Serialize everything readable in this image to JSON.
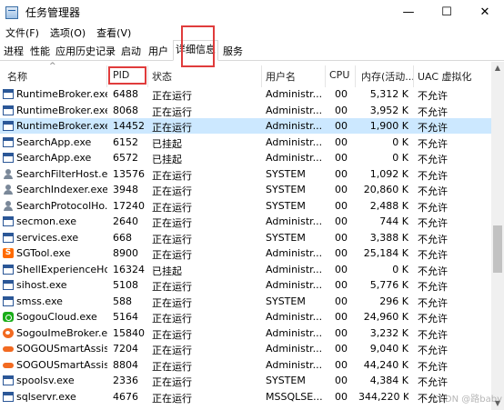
{
  "window": {
    "title": "任务管理器",
    "controls": [
      "—",
      "☐",
      "✕"
    ]
  },
  "menu": [
    "文件(F)",
    "选项(O)",
    "查看(V)"
  ],
  "tabs": [
    {
      "label": "进程",
      "active": false
    },
    {
      "label": "性能",
      "active": false
    },
    {
      "label": "应用历史记录",
      "active": false
    },
    {
      "label": "启动",
      "active": false
    },
    {
      "label": "用户",
      "active": false
    },
    {
      "label": "详细信息",
      "active": true
    },
    {
      "label": "服务",
      "active": false
    }
  ],
  "columns": {
    "name": "名称",
    "pid": "PID",
    "status": "状态",
    "user": "用户名",
    "cpu": "CPU",
    "memory": "内存(活动...",
    "uac": "UAC 虚拟化"
  },
  "rows": [
    {
      "icon": "window-icon",
      "name": "RuntimeBroker.exe",
      "pid": "6488",
      "status": "正在运行",
      "user": "Administr...",
      "cpu": "00",
      "mem": "5,312 K",
      "uac": "不允许"
    },
    {
      "icon": "window-icon",
      "name": "RuntimeBroker.exe",
      "pid": "8068",
      "status": "正在运行",
      "user": "Administr...",
      "cpu": "00",
      "mem": "3,952 K",
      "uac": "不允许"
    },
    {
      "icon": "window-icon",
      "name": "RuntimeBroker.exe",
      "pid": "14452",
      "status": "正在运行",
      "user": "Administr...",
      "cpu": "00",
      "mem": "1,900 K",
      "uac": "不允许",
      "selected": true
    },
    {
      "icon": "window-icon",
      "name": "SearchApp.exe",
      "pid": "6152",
      "status": "已挂起",
      "user": "Administr...",
      "cpu": "00",
      "mem": "0 K",
      "uac": "不允许"
    },
    {
      "icon": "window-icon",
      "name": "SearchApp.exe",
      "pid": "6572",
      "status": "已挂起",
      "user": "Administr...",
      "cpu": "00",
      "mem": "0 K",
      "uac": "不允许"
    },
    {
      "icon": "person-icon",
      "name": "SearchFilterHost.exe",
      "pid": "13576",
      "status": "正在运行",
      "user": "SYSTEM",
      "cpu": "00",
      "mem": "1,092 K",
      "uac": "不允许"
    },
    {
      "icon": "person-icon",
      "name": "SearchIndexer.exe",
      "pid": "3948",
      "status": "正在运行",
      "user": "SYSTEM",
      "cpu": "00",
      "mem": "20,860 K",
      "uac": "不允许"
    },
    {
      "icon": "person-icon",
      "name": "SearchProtocolHo...",
      "pid": "17240",
      "status": "正在运行",
      "user": "SYSTEM",
      "cpu": "00",
      "mem": "2,488 K",
      "uac": "不允许"
    },
    {
      "icon": "window-icon",
      "name": "secmon.exe",
      "pid": "2640",
      "status": "正在运行",
      "user": "Administr...",
      "cpu": "00",
      "mem": "744 K",
      "uac": "不允许"
    },
    {
      "icon": "window-icon",
      "name": "services.exe",
      "pid": "668",
      "status": "正在运行",
      "user": "SYSTEM",
      "cpu": "00",
      "mem": "3,388 K",
      "uac": "不允许"
    },
    {
      "icon": "sgtool-icon",
      "name": "SGTool.exe",
      "pid": "8900",
      "status": "正在运行",
      "user": "Administr...",
      "cpu": "00",
      "mem": "25,184 K",
      "uac": "不允许"
    },
    {
      "icon": "window-icon",
      "name": "ShellExperienceHo...",
      "pid": "16324",
      "status": "已挂起",
      "user": "Administr...",
      "cpu": "00",
      "mem": "0 K",
      "uac": "不允许"
    },
    {
      "icon": "window-icon",
      "name": "sihost.exe",
      "pid": "5108",
      "status": "正在运行",
      "user": "Administr...",
      "cpu": "00",
      "mem": "5,776 K",
      "uac": "不允许"
    },
    {
      "icon": "window-icon",
      "name": "smss.exe",
      "pid": "588",
      "status": "正在运行",
      "user": "SYSTEM",
      "cpu": "00",
      "mem": "296 K",
      "uac": "不允许"
    },
    {
      "icon": "sogou-cloud-icon",
      "name": "SogouCloud.exe",
      "pid": "5164",
      "status": "正在运行",
      "user": "Administr...",
      "cpu": "00",
      "mem": "24,960 K",
      "uac": "不允许"
    },
    {
      "icon": "sogou-icon",
      "name": "SogouImeBroker.e...",
      "pid": "15840",
      "status": "正在运行",
      "user": "Administr...",
      "cpu": "00",
      "mem": "3,232 K",
      "uac": "不允许"
    },
    {
      "icon": "sogou-smart-icon",
      "name": "SOGOUSmartAssis...",
      "pid": "7204",
      "status": "正在运行",
      "user": "Administr...",
      "cpu": "00",
      "mem": "9,040 K",
      "uac": "不允许"
    },
    {
      "icon": "sogou-smart-icon",
      "name": "SOGOUSmartAssis...",
      "pid": "8804",
      "status": "正在运行",
      "user": "Administr...",
      "cpu": "00",
      "mem": "44,240 K",
      "uac": "不允许"
    },
    {
      "icon": "window-icon",
      "name": "spoolsv.exe",
      "pid": "2336",
      "status": "正在运行",
      "user": "SYSTEM",
      "cpu": "00",
      "mem": "4,384 K",
      "uac": "不允许"
    },
    {
      "icon": "window-icon",
      "name": "sqlservr.exe",
      "pid": "4676",
      "status": "正在运行",
      "user": "MSSQLSE...",
      "cpu": "00",
      "mem": "344,220 K",
      "uac": "不允许"
    }
  ],
  "watermark": "CSDN @路baby",
  "colors": {
    "selected_row": "#cce8ff",
    "highlight_box": "#e03c3c"
  }
}
